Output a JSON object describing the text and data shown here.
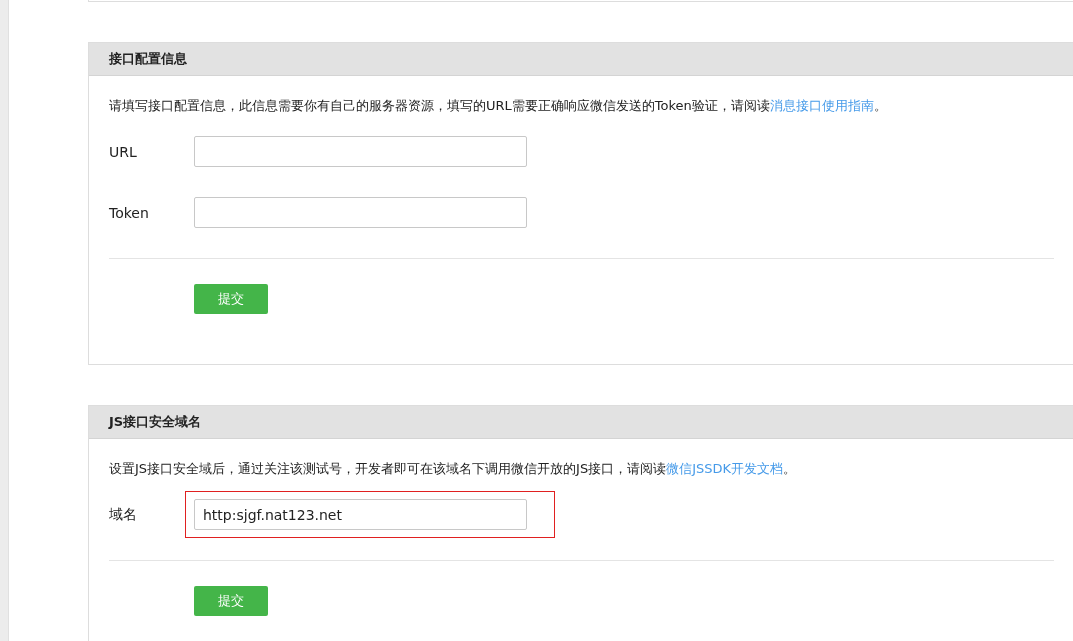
{
  "sections": [
    {
      "title": "接口配置信息",
      "intro": {
        "text": "请填写接口配置信息，此信息需要你有自己的服务器资源，填写的URL需要正确响应微信发送的Token验证，请阅读",
        "link": "消息接口使用指南",
        "after": "。"
      },
      "fields": [
        {
          "label": "URL",
          "highlighted": false
        },
        {
          "label": "Token",
          "highlighted": false
        }
      ],
      "button": "提交"
    },
    {
      "title": "JS接口安全域名",
      "intro": {
        "text": "设置JS接口安全域后，通过关注该测试号，开发者即可在该域名下调用微信开放的JS接口，请阅读",
        "link": "微信JSSDK开发文档",
        "after": "。"
      },
      "fields": [
        {
          "label": "域名",
          "value": "http:sjgf.nat123.net",
          "highlighted": true
        }
      ],
      "button": "提交"
    }
  ]
}
